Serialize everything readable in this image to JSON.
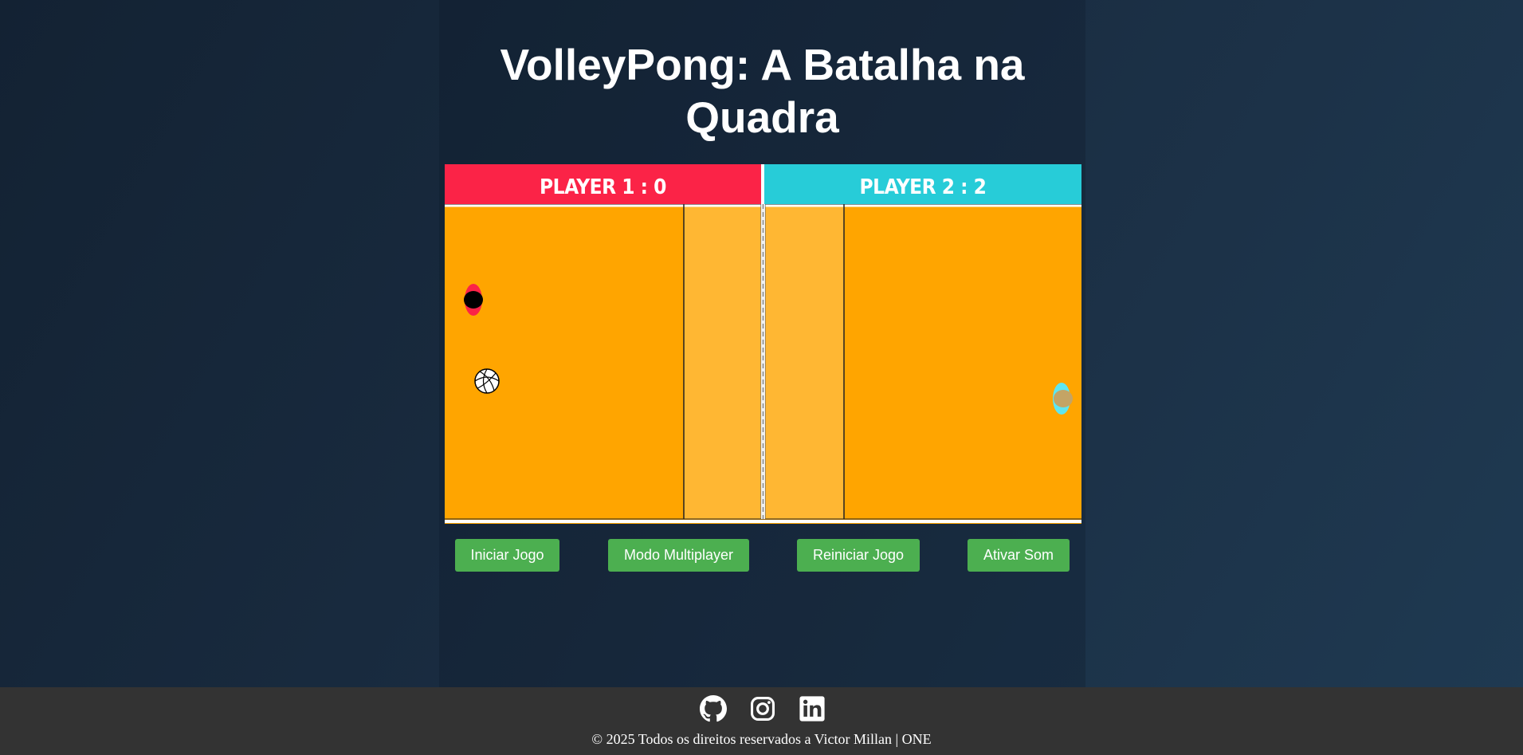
{
  "page": {
    "title": "VolleyPong: A Batalha na Quadra"
  },
  "scoreboard": {
    "player1": "PLAYER 1 : 0",
    "player2": "PLAYER 2 : 2",
    "player1_color": "#fb2347",
    "player2_color": "#27ccd8"
  },
  "game": {
    "court_color": "#ffa500",
    "attack_zone_color": "#ffb733",
    "line_color": "#ffffff",
    "player1_paddle_color": "#fb2347",
    "player2_paddle_color": "#5fe6f0",
    "ball_icon": "volleyball-icon"
  },
  "controls": {
    "start_label": "Iniciar Jogo",
    "multiplayer_label": "Modo Multiplayer",
    "restart_label": "Reiniciar Jogo",
    "sound_label": "Ativar Som",
    "button_color": "#4caf50"
  },
  "footer": {
    "social": [
      "github-icon",
      "instagram-icon",
      "linkedin-icon"
    ],
    "copyright": "© 2025 Todos os direitos reservados a Victor Millan | ONE"
  }
}
